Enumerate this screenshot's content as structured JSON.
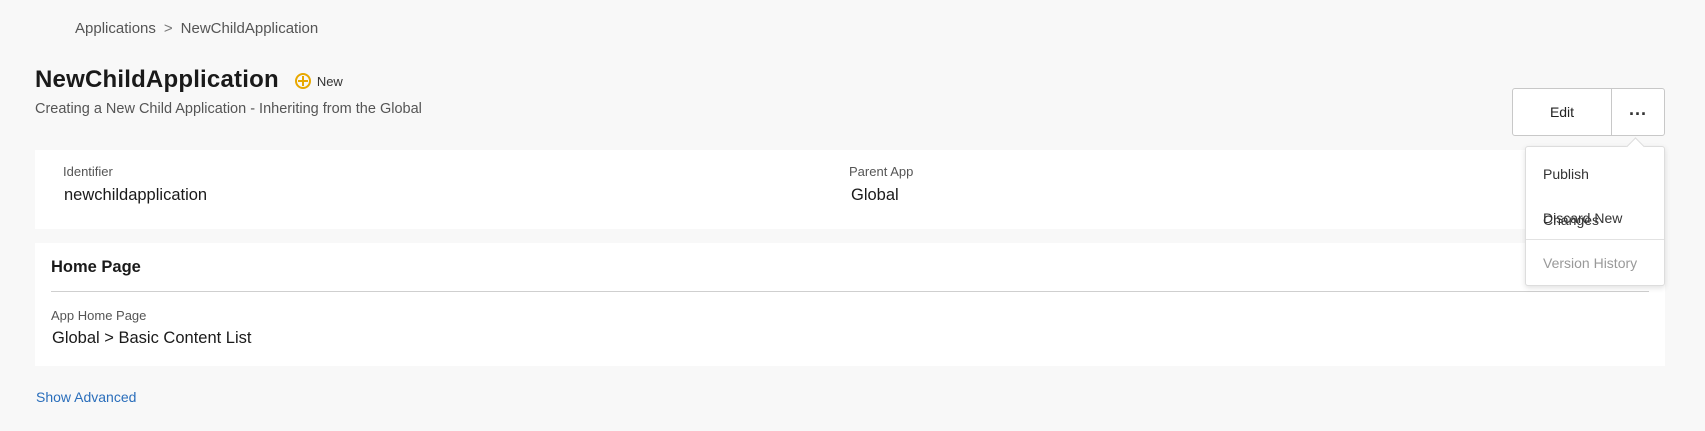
{
  "breadcrumb": {
    "root": "Applications",
    "separator": ">",
    "current": "NewChildApplication"
  },
  "header": {
    "title": "NewChildApplication",
    "status_label": "New",
    "status_icon": "plus-circle-icon",
    "status_color": "#e8a800",
    "subtitle": "Creating a New Child Application - Inheriting from the Global"
  },
  "actions": {
    "edit_label": "Edit",
    "more_icon": "ellipsis-icon"
  },
  "menu": {
    "items": [
      {
        "label": "Publish Changes",
        "enabled": true
      },
      {
        "label": "Discard New",
        "enabled": true
      },
      {
        "label": "Version History",
        "enabled": false
      }
    ]
  },
  "info": {
    "identifier_label": "Identifier",
    "identifier_value": "newchildapplication",
    "parent_label": "Parent App",
    "parent_value": "Global"
  },
  "home_page": {
    "section_title": "Home Page",
    "field_label": "App Home Page",
    "field_value": "Global > Basic Content List"
  },
  "show_advanced_label": "Show Advanced",
  "colors": {
    "background": "#f8f8f8",
    "link": "#2a6ebb",
    "disabled_text": "#999999"
  }
}
